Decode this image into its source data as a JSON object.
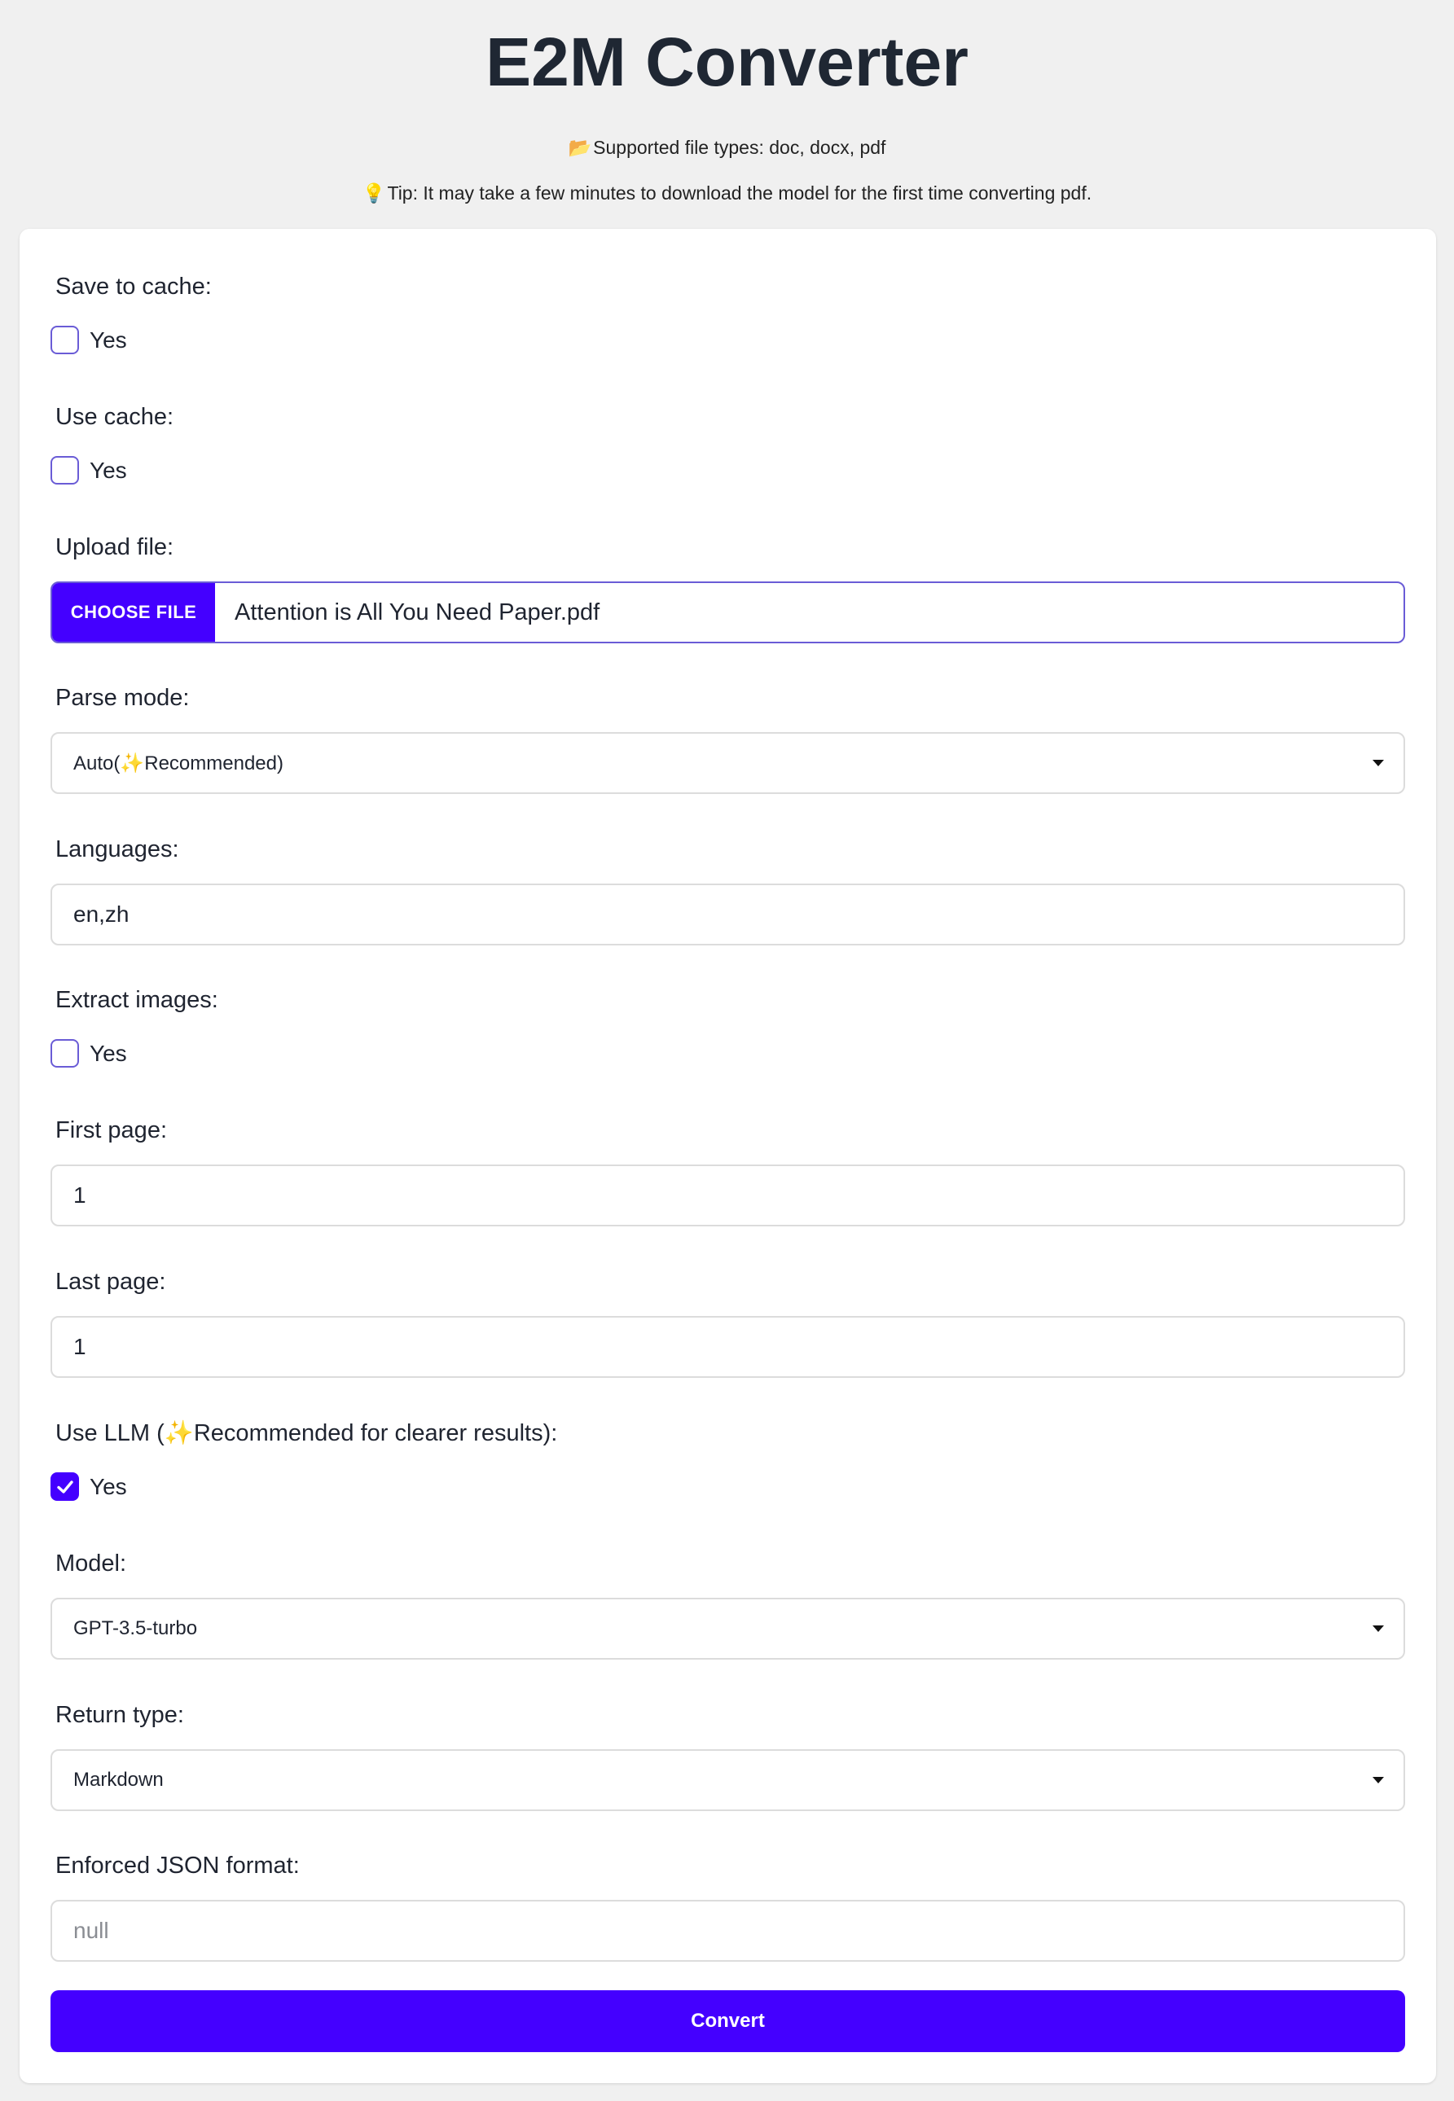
{
  "header": {
    "title": "E2M Converter",
    "supported_icon": "📂",
    "supported_text": "Supported file types: doc, docx, pdf",
    "tip_icon": "💡",
    "tip_text": "Tip: It may take a few minutes to download the model for the first time converting pdf."
  },
  "form": {
    "save_cache": {
      "label": "Save to cache:",
      "option": "Yes",
      "checked": false
    },
    "use_cache": {
      "label": "Use cache:",
      "option": "Yes",
      "checked": false
    },
    "upload": {
      "label": "Upload file:",
      "button": "CHOOSE FILE",
      "file_name": "Attention is All You Need Paper.pdf"
    },
    "parse_mode": {
      "label": "Parse mode:",
      "value": "Auto(✨Recommended)"
    },
    "languages": {
      "label": "Languages:",
      "value": "en,zh"
    },
    "extract_images": {
      "label": "Extract images:",
      "option": "Yes",
      "checked": false
    },
    "first_page": {
      "label": "First page:",
      "value": "1"
    },
    "last_page": {
      "label": "Last page:",
      "value": "1"
    },
    "use_llm": {
      "label": "Use LLM (✨Recommended for clearer results):",
      "option": "Yes",
      "checked": true
    },
    "model": {
      "label": "Model:",
      "value": "GPT-3.5-turbo"
    },
    "return_type": {
      "label": "Return type:",
      "value": "Markdown"
    },
    "json_format": {
      "label": "Enforced JSON format:",
      "placeholder": "null"
    },
    "convert_button": "Convert"
  },
  "colors": {
    "accent": "#4400ff",
    "background": "#f0f0f0",
    "card": "#ffffff"
  }
}
